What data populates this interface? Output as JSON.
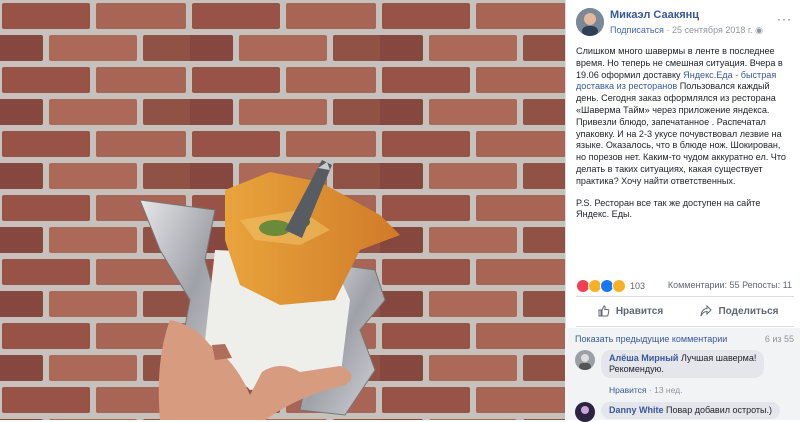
{
  "post": {
    "author": "Микаэл Саакянц",
    "follow_label": "Подписаться",
    "date": "25 сентября 2018 г.",
    "more_label": "···",
    "text_before_link": "Слишком много шавермы в ленте в последнее время. Но теперь не смешная ситуация. Вчера в 19.06 оформил доставку ",
    "link_text": "Яндекс.Еда - быстрая доставка из ресторанов",
    "text_after_link": " Пользовался каждый день. Сегодня заказ оформлялся из ресторана «Шаверма Тайм» через приложение яндекса. Привезли блюдо, запечатанное . Распечатал упаковку. И на 2-3 укусе почувствовал лезвие на языке. Оказалось, что в блюде нож. Шокирован, но порезов нет. Каким-то чудом аккуратно ел. Что делать в таких ситуациях, какая существует практика? Хочу найти ответственных.",
    "ps": "P.S. Ресторан все так же доступен на сайте Яндекс. Еды."
  },
  "stats": {
    "reactions_count": "103",
    "comments": "Комментарии: 55",
    "reposts": "Репосты: 11",
    "reaction_colors": [
      "#f33e58",
      "#f7b125",
      "#1877f2",
      "#f7b125"
    ]
  },
  "actions": {
    "like_label": "Нравится",
    "share_label": "Поделиться"
  },
  "comments": {
    "show_previous": "Показать предыдущие комментарии",
    "counter": "6 из 55",
    "items": [
      {
        "name": "Алёша Мирный",
        "text_line1": "Лучшая шаверма!",
        "text_line2": "Рекомендую.",
        "like_label": "Нравится",
        "age": "13 нед."
      },
      {
        "name": "Danny White",
        "text_line1": "Повар добавил остроты.)"
      }
    ]
  },
  "colors": {
    "link": "#385898",
    "muted": "#90949c",
    "accent": "#4267b2"
  }
}
